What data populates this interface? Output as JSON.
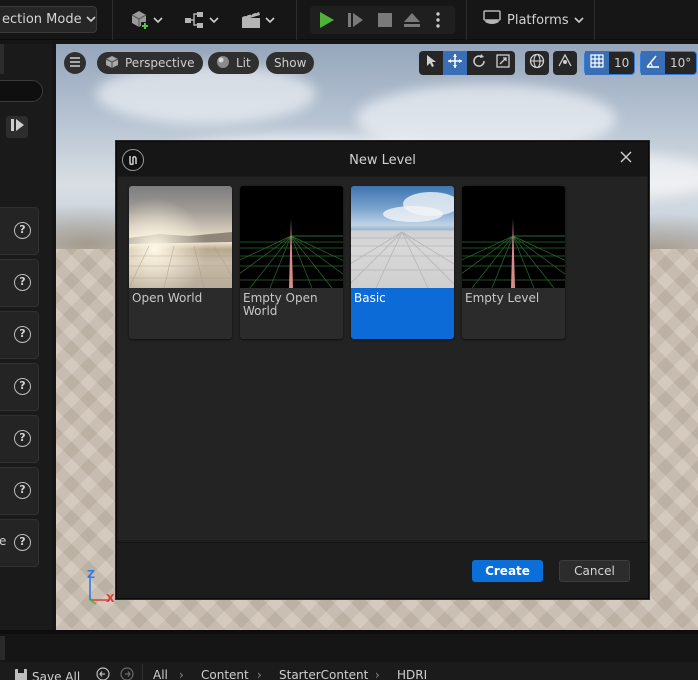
{
  "toolbar": {
    "mode_label": "ection Mode",
    "platforms_label": "Platforms"
  },
  "viewport": {
    "perspective_label": "Perspective",
    "lit_label": "Lit",
    "show_label": "Show",
    "grid_snap_value": "10",
    "rotation_snap_value": "10°",
    "axis_z": "Z",
    "axis_x": "X"
  },
  "left_panel": {
    "card_fragment": "e"
  },
  "dialog": {
    "title": "New Level",
    "templates": [
      {
        "label": "Open World",
        "selected": false
      },
      {
        "label": "Empty Open World",
        "selected": false
      },
      {
        "label": "Basic",
        "selected": true
      },
      {
        "label": "Empty Level",
        "selected": false
      }
    ],
    "create_label": "Create",
    "cancel_label": "Cancel"
  },
  "bottom_bar": {
    "save_all_label": "Save All",
    "breadcrumbs": [
      "All",
      "Content",
      "StarterContent",
      "HDRI"
    ]
  },
  "colors": {
    "accent": "#0b6fd9",
    "play_green": "#4fb33a"
  }
}
